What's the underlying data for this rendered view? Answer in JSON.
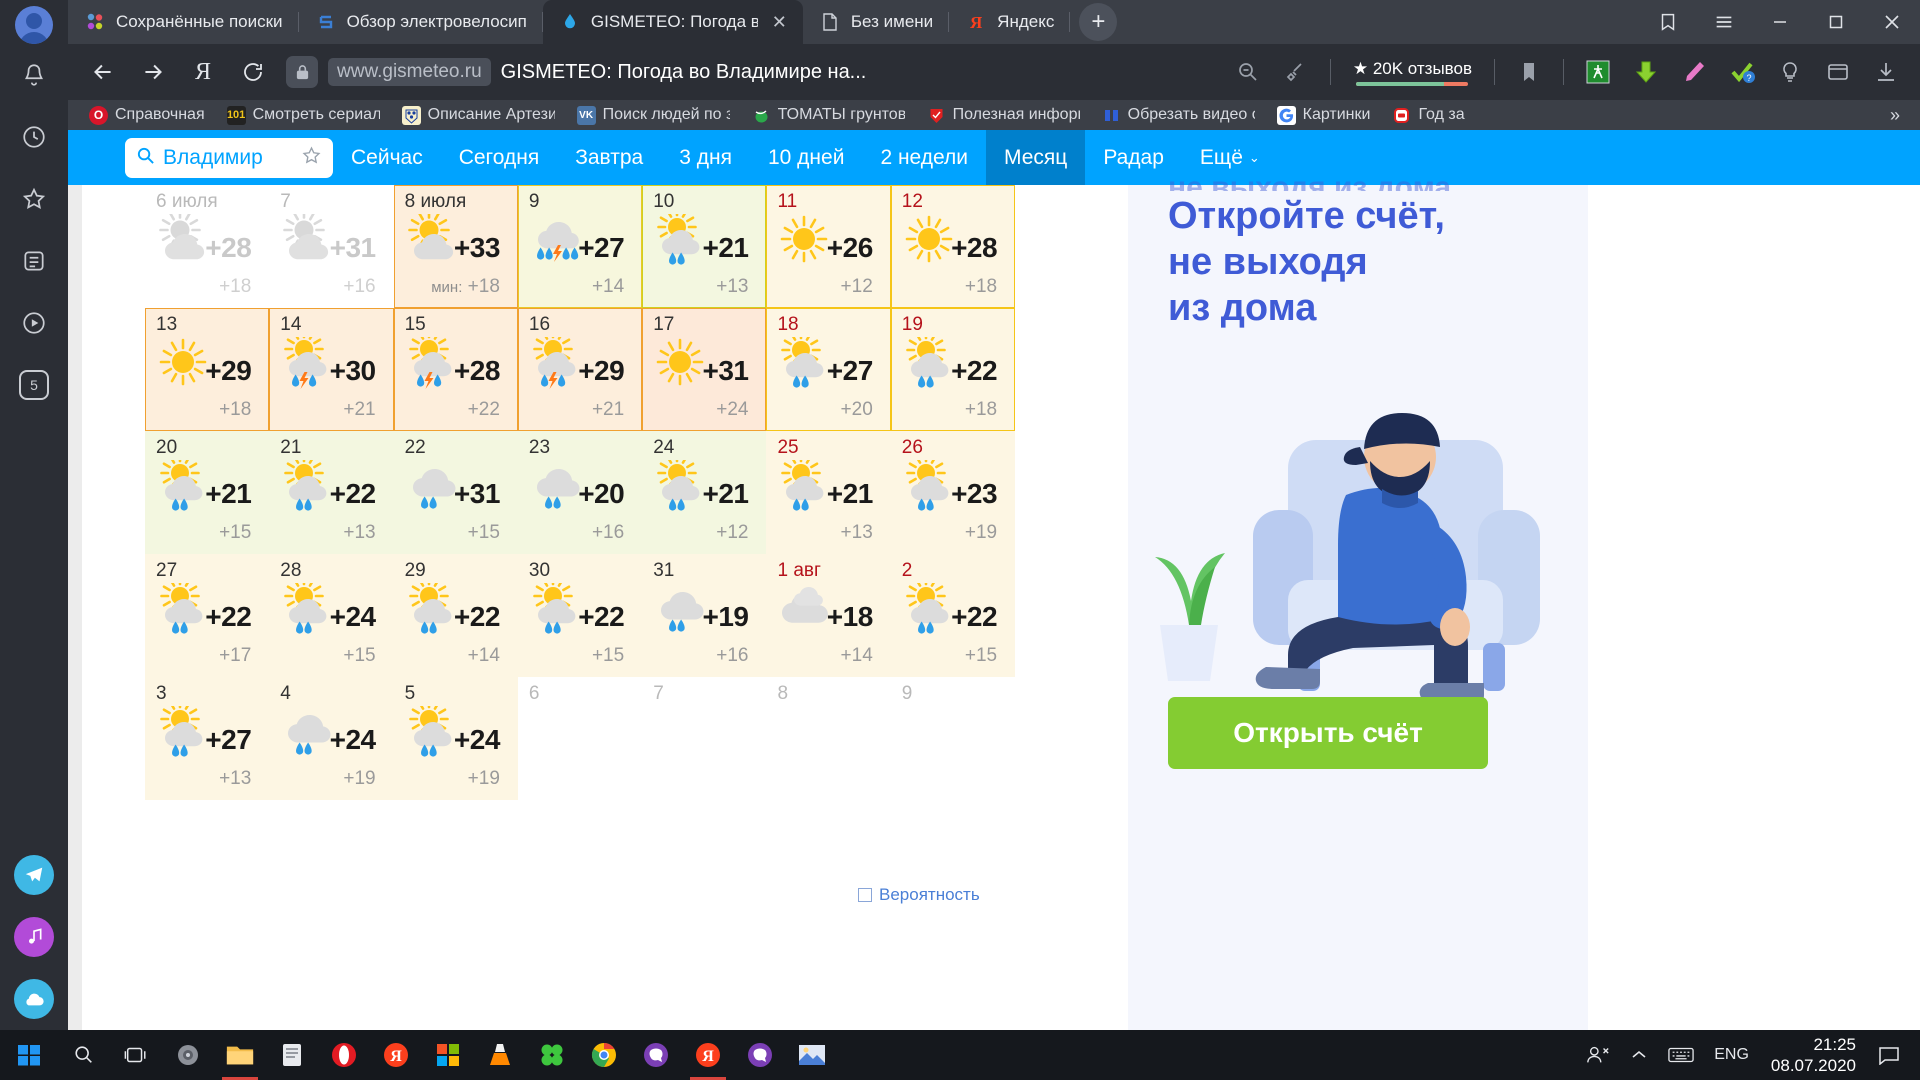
{
  "browser": {
    "tabs": [
      {
        "title": "Сохранённые поиски",
        "icon": "dots-colored-icon",
        "active": false
      },
      {
        "title": "Обзор электровелосип",
        "icon": "s-logo-icon",
        "active": false
      },
      {
        "title": "GISMETEO: Погода в",
        "icon": "gismeteo-drop-icon",
        "active": true
      },
      {
        "title": "Без имени",
        "icon": "page-icon",
        "active": false
      },
      {
        "title": "Яндекс",
        "icon": "yandex-icon",
        "active": false
      }
    ],
    "new_tab_label": "+",
    "window_controls": {
      "minimize": "—",
      "maximize": "□",
      "close": "✕",
      "collections": "▭",
      "menu": "☰"
    },
    "address": {
      "domain": "www.gismeteo.ru",
      "page_title": "GISMETEO: Погода во Владимире на...",
      "back": "←",
      "forward": "→",
      "home": "Я",
      "reload": "⟳",
      "zoom_out_icon": "zoom-minus-icon",
      "clean_icon": "broom-icon"
    },
    "reviews_badge": {
      "stars": "★",
      "text": "20K отзывов"
    },
    "extensions": [
      "bookmark-icon",
      "translate-icon",
      "download-green-icon",
      "pen-icon",
      "check-icon",
      "lightbulb-icon",
      "window-icon",
      "download-tray-icon"
    ],
    "bookmarks": [
      {
        "label": "Справочная",
        "icon": "opera-red-icon"
      },
      {
        "label": "Смотреть сериалы",
        "icon": "101-icon"
      },
      {
        "label": "Описание Артезиа",
        "icon": "crest-icon"
      },
      {
        "label": "Поиск людей по за",
        "icon": "vk-icon"
      },
      {
        "label": "ТОМАТЫ грунтовые",
        "icon": "tomato-green-icon"
      },
      {
        "label": "Полезная информа",
        "icon": "red-shield-icon"
      },
      {
        "label": "Обрезать видео он",
        "icon": "blue-bars-icon"
      },
      {
        "label": "Картинки",
        "icon": "google-icon"
      },
      {
        "label": "Год за",
        "icon": "red-rounded-icon"
      }
    ],
    "bookmarks_more": "»"
  },
  "site": {
    "search": {
      "value": "Владимир",
      "icon": "search-icon",
      "favorite_icon": "star-icon"
    },
    "nav": [
      {
        "label": "Сейчас",
        "active": false
      },
      {
        "label": "Сегодня",
        "active": false
      },
      {
        "label": "Завтра",
        "active": false
      },
      {
        "label": "3 дня",
        "active": false
      },
      {
        "label": "10 дней",
        "active": false
      },
      {
        "label": "2 недели",
        "active": false
      },
      {
        "label": "Месяц",
        "active": true
      },
      {
        "label": "Радар",
        "active": false
      },
      {
        "label": "Ещё",
        "active": false,
        "caret": "⌄"
      }
    ]
  },
  "calendar": {
    "night_label": "мин:",
    "days": [
      {
        "num": "6 июля",
        "icon": "sun-cloud",
        "day": "+28",
        "night": "+18",
        "style": "muted"
      },
      {
        "num": "7",
        "icon": "sun-cloud",
        "day": "+31",
        "night": "+16",
        "style": "muted"
      },
      {
        "num": "8 июля",
        "icon": "sun-cloud",
        "day": "+33",
        "night": "+18",
        "night_label": "мин:",
        "style": "today"
      },
      {
        "num": "9",
        "icon": "cloud-storm",
        "day": "+27",
        "night": "+14",
        "style": "lemon"
      },
      {
        "num": "10",
        "icon": "sun-cloud-rain",
        "day": "+21",
        "night": "+13",
        "style": "lgreen"
      },
      {
        "num": "11",
        "icon": "sun",
        "day": "+26",
        "night": "+12",
        "style": "cream",
        "weekend": true
      },
      {
        "num": "12",
        "icon": "sun",
        "day": "+28",
        "night": "+18",
        "style": "cream",
        "weekend": true
      },
      {
        "num": "13",
        "icon": "sun",
        "day": "+29",
        "night": "+18",
        "style": "peach"
      },
      {
        "num": "14",
        "icon": "sun-cloud-storm",
        "day": "+30",
        "night": "+21",
        "style": "peach"
      },
      {
        "num": "15",
        "icon": "sun-cloud-storm",
        "day": "+28",
        "night": "+22",
        "style": "peach"
      },
      {
        "num": "16",
        "icon": "sun-cloud-storm",
        "day": "+29",
        "night": "+21",
        "style": "peach"
      },
      {
        "num": "17",
        "icon": "sun",
        "day": "+31",
        "night": "+24",
        "style": "peach2"
      },
      {
        "num": "18",
        "icon": "sun-cloud-rain",
        "day": "+27",
        "night": "+20",
        "style": "cream",
        "weekend": true
      },
      {
        "num": "19",
        "icon": "sun-cloud-rain",
        "day": "+22",
        "night": "+18",
        "style": "cream",
        "weekend": true
      },
      {
        "num": "20",
        "icon": "sun-cloud-rain",
        "day": "+21",
        "night": "+15",
        "style": "lgreen"
      },
      {
        "num": "21",
        "icon": "sun-cloud-rain",
        "day": "+22",
        "night": "+13",
        "style": "lgreen"
      },
      {
        "num": "22",
        "icon": "cloud-rain",
        "day": "+31",
        "night": "+15",
        "style": "lgreen"
      },
      {
        "num": "23",
        "icon": "cloud-rain",
        "day": "+20",
        "night": "+16",
        "style": "lgreen"
      },
      {
        "num": "24",
        "icon": "sun-cloud-rain",
        "day": "+21",
        "night": "+12",
        "style": "lgreen"
      },
      {
        "num": "25",
        "icon": "sun-cloud-rain",
        "day": "+21",
        "night": "+13",
        "style": "cream",
        "weekend": true
      },
      {
        "num": "26",
        "icon": "sun-cloud-rain",
        "day": "+23",
        "night": "+19",
        "style": "cream",
        "weekend": true
      },
      {
        "num": "27",
        "icon": "sun-cloud-rain",
        "day": "+22",
        "night": "+17",
        "style": "cream"
      },
      {
        "num": "28",
        "icon": "sun-cloud-rain",
        "day": "+24",
        "night": "+15",
        "style": "cream"
      },
      {
        "num": "29",
        "icon": "sun-cloud-rain",
        "day": "+22",
        "night": "+14",
        "style": "cream"
      },
      {
        "num": "30",
        "icon": "sun-cloud-rain",
        "day": "+22",
        "night": "+15",
        "style": "cream"
      },
      {
        "num": "31",
        "icon": "cloud-rain",
        "day": "+19",
        "night": "+16",
        "style": "cream"
      },
      {
        "num": "1 авг",
        "icon": "cloud",
        "day": "+18",
        "night": "+14",
        "style": "cream",
        "weekend": true
      },
      {
        "num": "2",
        "icon": "sun-cloud-rain",
        "day": "+22",
        "night": "+15",
        "style": "cream",
        "weekend": true
      },
      {
        "num": "3",
        "icon": "sun-cloud-rain",
        "day": "+27",
        "night": "+13",
        "style": "cream"
      },
      {
        "num": "4",
        "icon": "cloud-rain",
        "day": "+24",
        "night": "+19",
        "style": "cream"
      },
      {
        "num": "5",
        "icon": "sun-cloud-rain",
        "day": "+24",
        "night": "+19",
        "style": "cream"
      },
      {
        "num": "6",
        "icon": "",
        "day": "",
        "night": "",
        "style": "muted-empty"
      },
      {
        "num": "7",
        "icon": "",
        "day": "",
        "night": "",
        "style": "muted-empty"
      },
      {
        "num": "8",
        "icon": "",
        "day": "",
        "night": "",
        "style": "muted-empty"
      },
      {
        "num": "9",
        "icon": "",
        "day": "",
        "night": "",
        "style": "muted-empty"
      }
    ]
  },
  "ad": {
    "title_line1": "Откройте счёт,",
    "title_line2": "не выходя",
    "title_line3": "из дома",
    "cta": "Открыть счёт",
    "clipped_top": "не выходя из дома"
  },
  "page_footer": {
    "checkbox_label": "Вероятность"
  },
  "taskbar": {
    "start_icon": "windows-icon",
    "search_icon": "search-icon",
    "taskview_icon": "task-view-icon",
    "apps": [
      "speaker-icon",
      "file-explorer-icon",
      "notes-icon",
      "opera-icon",
      "yandex-red-icon",
      "store-icon",
      "vlc-icon",
      "clover-icon",
      "chrome-icon",
      "viber-icon",
      "yandex-browser-icon",
      "viber2-icon",
      "photos-icon"
    ],
    "tray": {
      "people_icon": "people-icon",
      "chevron": "⌃",
      "keyboard_icon": "keyboard-icon",
      "language": "ENG",
      "notifications_icon": "notification-icon"
    },
    "time": "21:25",
    "date": "08.07.2020"
  },
  "colors": {
    "site_accent": "#00a3ff",
    "site_accent_active": "#0080cc",
    "ad_blue": "#3f5bd6",
    "cta_green": "#84cc32",
    "weekend_red": "#b5121b",
    "browser_chrome": "#2b2e35"
  }
}
